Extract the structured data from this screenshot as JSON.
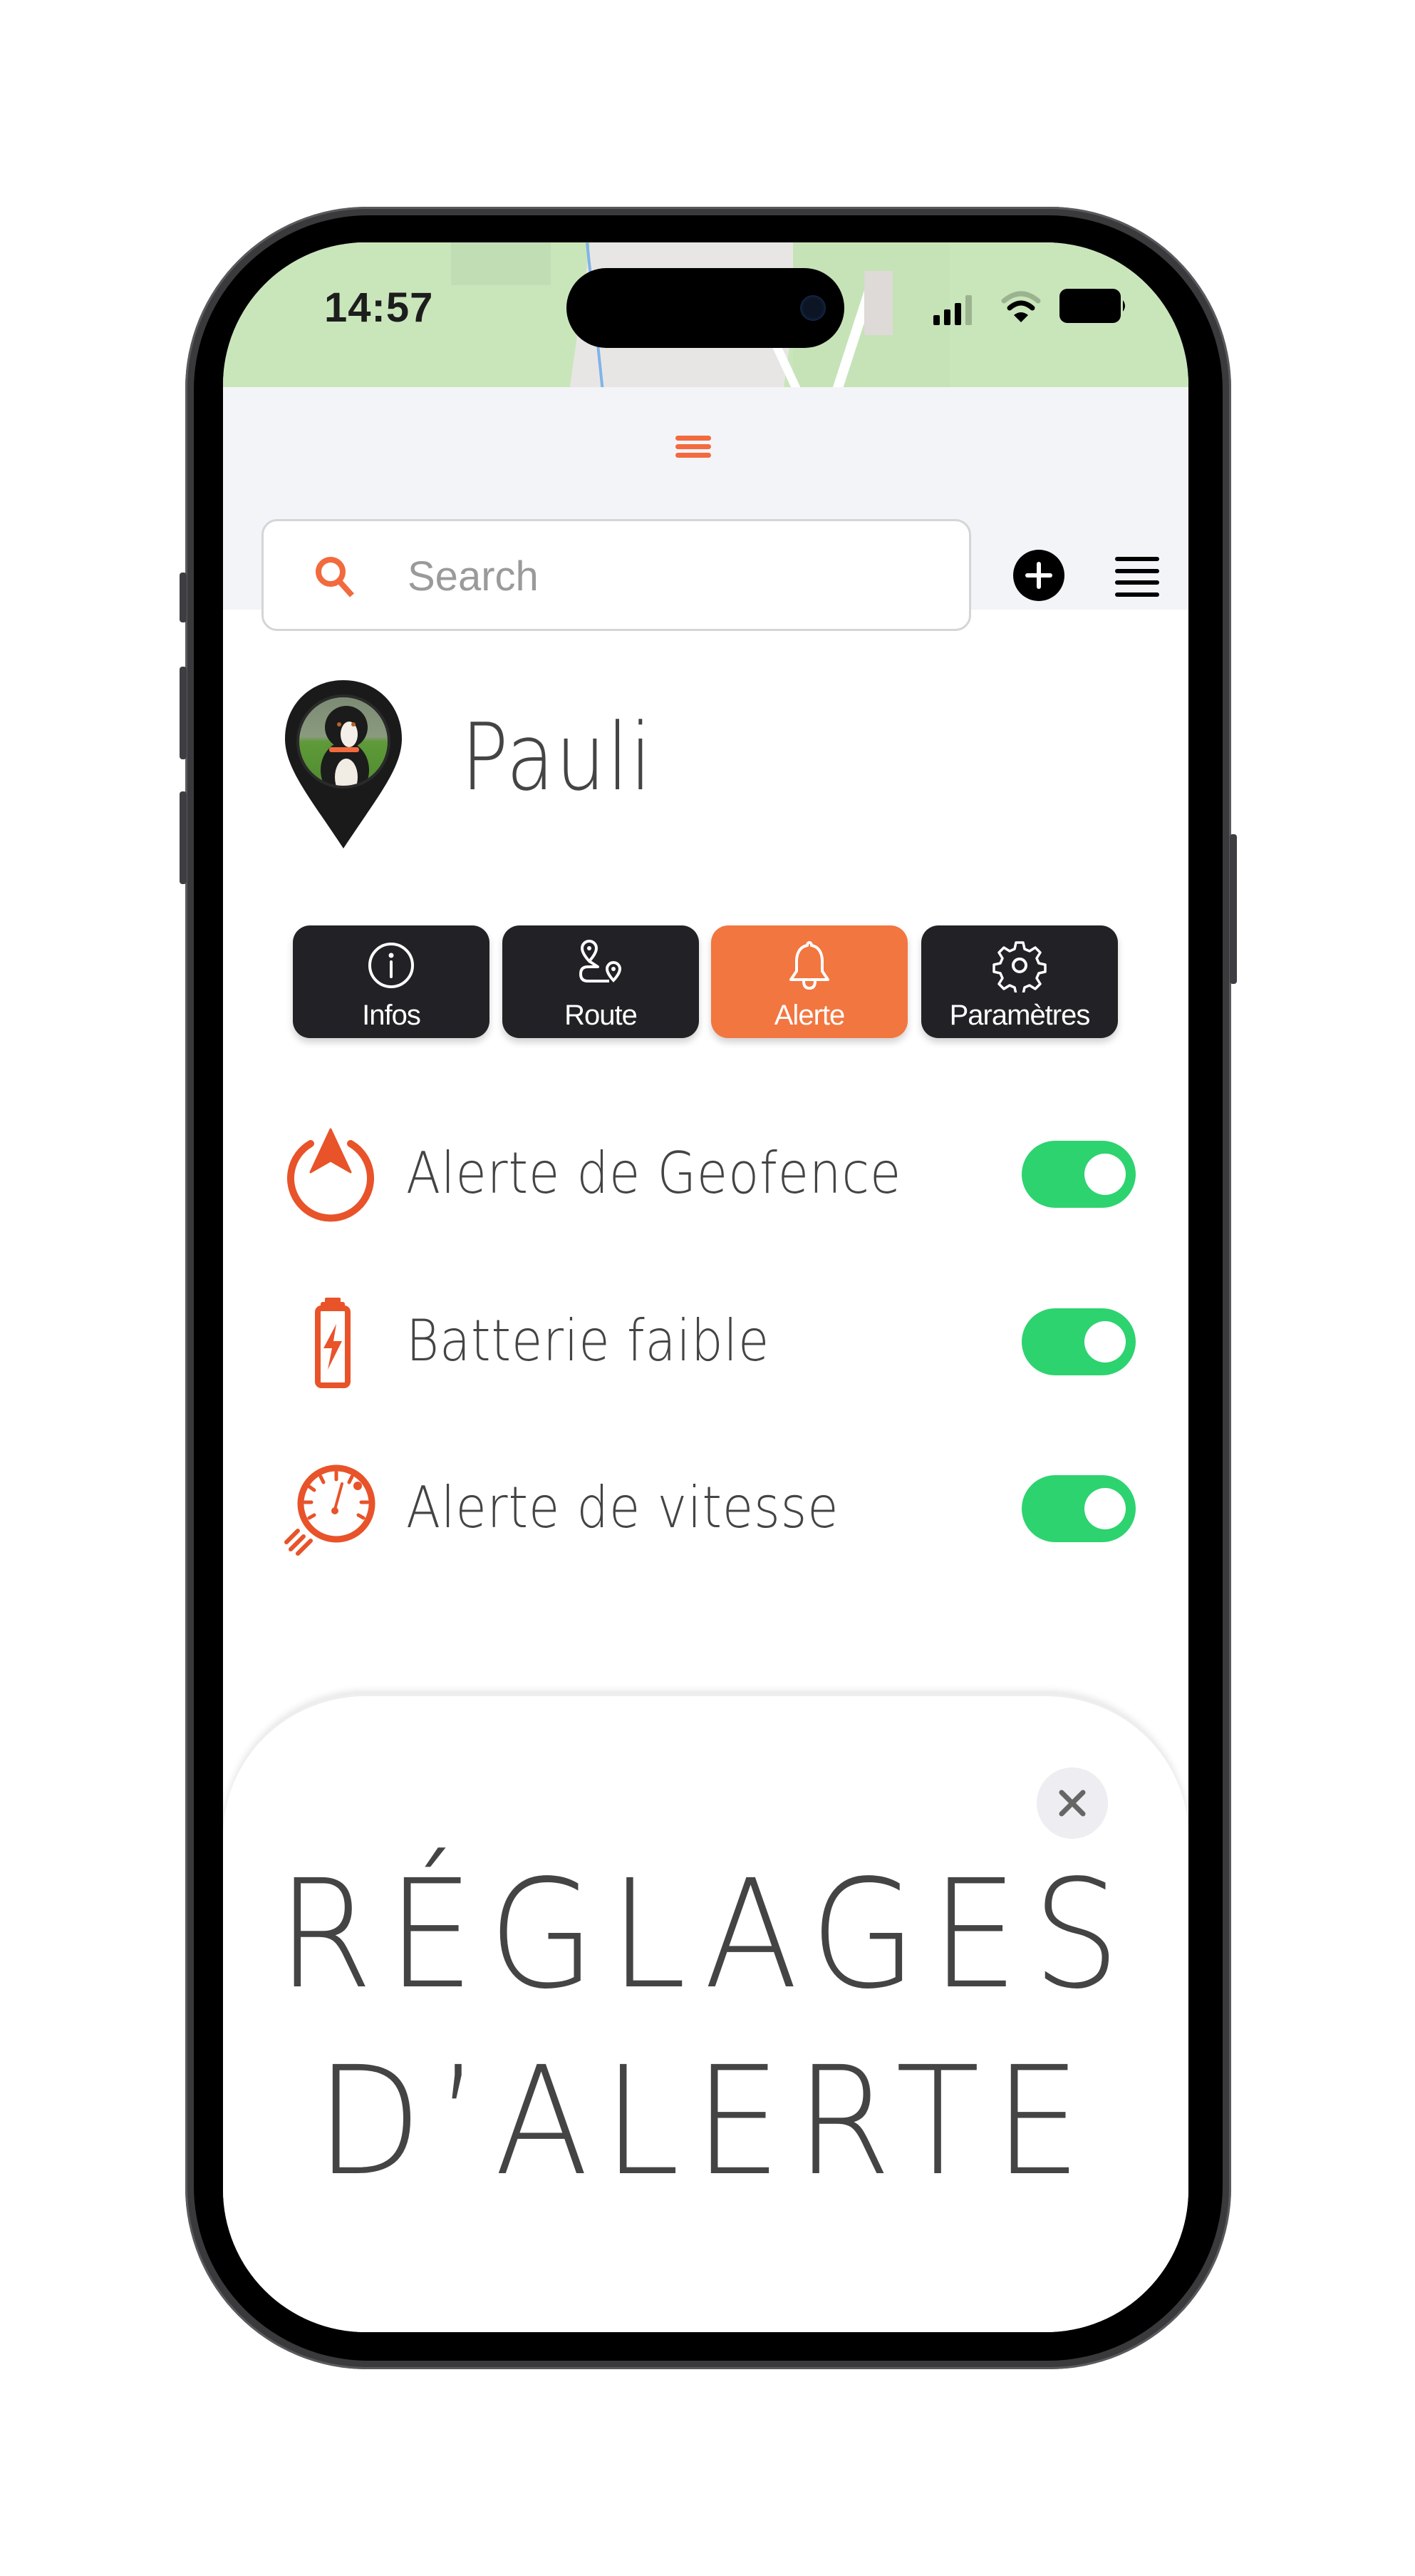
{
  "status_bar": {
    "time": "14:57",
    "icons": [
      "signal-icon",
      "wifi-icon",
      "battery-icon"
    ]
  },
  "header": {
    "grabber_icon": "drag-handle-icon",
    "search": {
      "placeholder": "Search",
      "value": "",
      "icon": "search-icon"
    },
    "add_button_icon": "plus-circle-icon",
    "list_button_icon": "list-icon"
  },
  "pet": {
    "name": "Pauli",
    "avatar_icon": "map-pin-avatar"
  },
  "tabs": [
    {
      "label": "Infos",
      "icon": "info-icon",
      "active": false
    },
    {
      "label": "Route",
      "icon": "route-icon",
      "active": false
    },
    {
      "label": "Alerte",
      "icon": "bell-icon",
      "active": true
    },
    {
      "label": "Paramètres",
      "icon": "gear-icon",
      "active": false
    }
  ],
  "alerts": [
    {
      "label": "Alerte de Geofence",
      "icon": "geofence-icon",
      "enabled": true
    },
    {
      "label": "Batterie faible",
      "icon": "battery-low-icon",
      "enabled": true
    },
    {
      "label": "Alerte de vitesse",
      "icon": "speedometer-icon",
      "enabled": true
    }
  ],
  "sheet": {
    "title_line1": "RÉGLAGES",
    "title_line2": "D’ALERTE",
    "close_icon": "close-icon"
  },
  "colors": {
    "accent": "#F27640",
    "icon_orange": "#E8532A",
    "toggle_on": "#2DD36F",
    "tab_dark": "#222226",
    "header_bg": "#F3F4F8"
  }
}
